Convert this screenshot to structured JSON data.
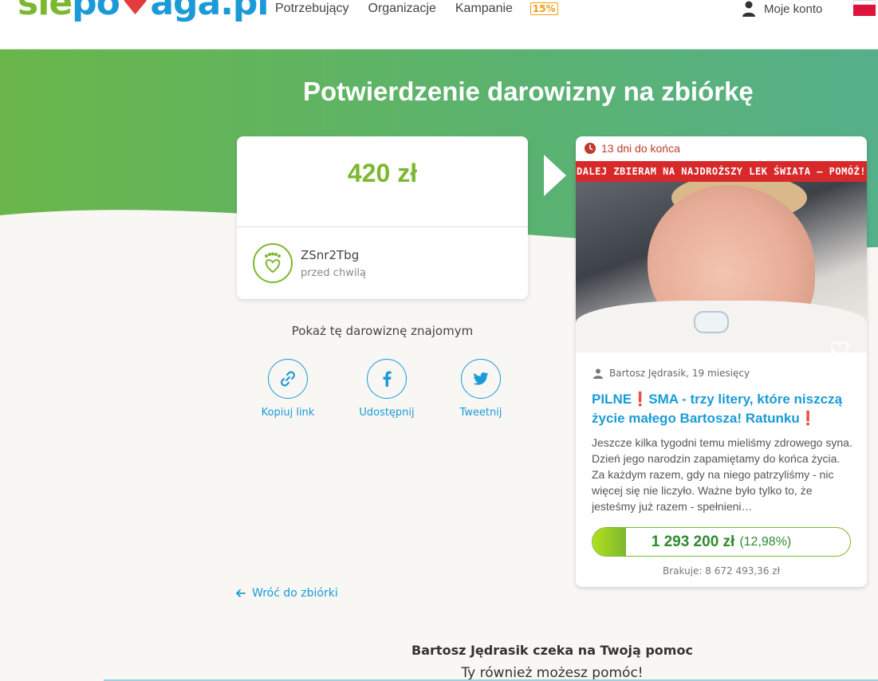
{
  "header": {
    "logo": {
      "part1": "sie",
      "part2": "po",
      "heart": "♥",
      "part3": "aga.pl"
    },
    "nav": [
      "Potrzebujący",
      "Organizacje",
      "Kampanie"
    ],
    "percent_badge": "15%",
    "account_label": "Moje konto",
    "language_flag": "pl-flag"
  },
  "hero": {
    "title": "Potwierdzenie darowizny na zbiórkę"
  },
  "donation": {
    "amount": "420 zł",
    "donor_name": "ZSnr2Tbg",
    "donor_time": "przed chwilą"
  },
  "share": {
    "heading": "Pokaż tę darowiznę znajomym",
    "items": [
      {
        "label": "Kopiuj link",
        "icon": "link-icon"
      },
      {
        "label": "Udostępnij",
        "icon": "facebook-icon"
      },
      {
        "label": "Tweetnij",
        "icon": "twitter-icon"
      }
    ]
  },
  "back_link": "Wróć do zbiórki",
  "campaign": {
    "deadline": "13 dni do końca",
    "banner": "DALEJ ZBIERAM NA NAJDROŻSZY LEK ŚWIATA – POMÓŻ!",
    "author": "Bartosz Jędrasik, 19 miesięcy",
    "title": "PILNE❗SMA - trzy litery, które niszczą życie małego Bartosza! Ratunku❗",
    "description": "Jeszcze kilka tygodni temu mieliśmy zdrowego syna. Dzień jego narodzin zapamiętamy do końca życia. Za każdym razem, gdy na niego patrzyliśmy - nic więcej się nie liczyło. Ważne było tylko to, że jesteśmy już razem - spełnieni…",
    "raised": "1 293 200 zł",
    "percent_label": "(12,98%)",
    "progress_fraction": 0.1298,
    "missing": "Brakuje: 8 672 493,36 zł"
  },
  "bottom": {
    "heading": "Bartosz Jędrasik czeka na Twoją pomoc",
    "subheading": "Ty również możesz pomóc!"
  },
  "colors": {
    "brand_green": "#7cb82f",
    "brand_blue": "#1a9bd7",
    "alert_red": "#d8292a"
  }
}
